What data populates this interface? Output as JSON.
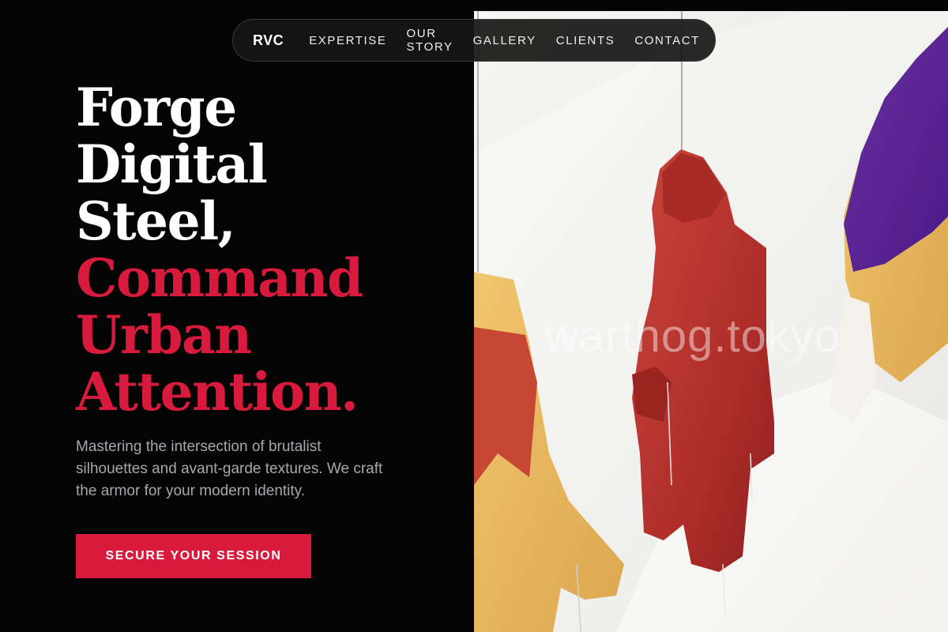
{
  "nav": {
    "brand": "RVC",
    "items": [
      {
        "label": "EXPERTISE"
      },
      {
        "label": "OUR STORY"
      },
      {
        "label": "GALLERY"
      },
      {
        "label": "CLIENTS"
      },
      {
        "label": "CONTACT"
      }
    ]
  },
  "hero": {
    "headline_white": [
      "Forge",
      "Digital",
      "Steel,"
    ],
    "headline_red": [
      "Command",
      "Urban",
      "Attention."
    ],
    "subtext": "Mastering the intersection of brutalist silhouettes and avant-garde textures. We craft the armor for your modern identity.",
    "cta_label": "SECURE YOUR SESSION"
  },
  "image": {
    "watermark": "warthog.tokyo",
    "subject": "hanging-jackets-photo"
  },
  "colors": {
    "accent": "#d81b3c",
    "background": "#040404",
    "text": "#ffffff",
    "muted_text": "#a7a7ad"
  }
}
